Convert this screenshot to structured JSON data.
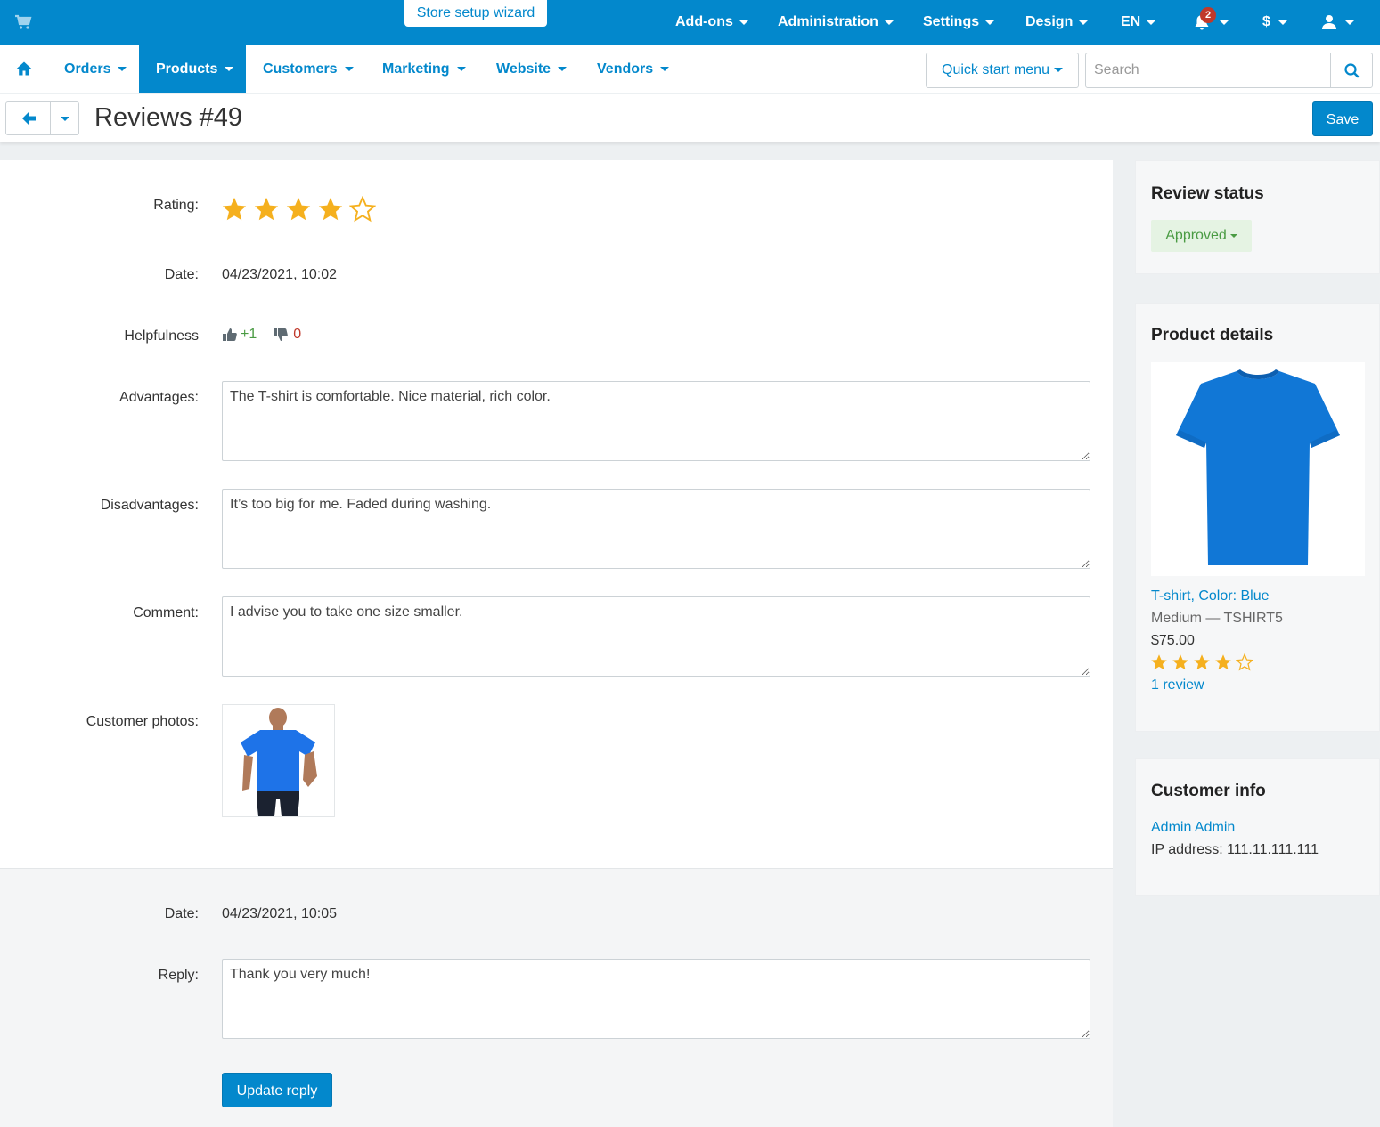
{
  "topbar": {
    "wizard_label": "Store setup wizard",
    "menu": [
      {
        "label": "Add-ons"
      },
      {
        "label": "Administration"
      },
      {
        "label": "Settings"
      },
      {
        "label": "Design"
      },
      {
        "label": "EN"
      }
    ],
    "notifications_count": "2",
    "currency_label": "$"
  },
  "nav": {
    "items": [
      {
        "label": "Orders"
      },
      {
        "label": "Products"
      },
      {
        "label": "Customers"
      },
      {
        "label": "Marketing"
      },
      {
        "label": "Website"
      },
      {
        "label": "Vendors"
      }
    ],
    "active": "Products",
    "quick_start_label": "Quick start menu",
    "search_placeholder": "Search"
  },
  "page": {
    "title": "Reviews #49",
    "save_label": "Save"
  },
  "review": {
    "rating_label": "Rating:",
    "rating": 4,
    "rating_max": 5,
    "date_label": "Date:",
    "date": "04/23/2021, 10:02",
    "helpfulness_label": "Helpfulness",
    "helpful_up": "+1",
    "helpful_down": "0",
    "advantages_label": "Advantages:",
    "advantages": "The T-shirt is comfortable. Nice material, rich color.",
    "disadvantages_label": "Disadvantages:",
    "disadvantages": "It’s too big for me. Faded during washing.",
    "comment_label": "Comment:",
    "comment": "I advise you to take one size smaller.",
    "photos_label": "Customer photos:"
  },
  "reply": {
    "date_label": "Date:",
    "date": "04/23/2021, 10:05",
    "reply_label": "Reply:",
    "reply": "Thank you very much!",
    "update_label": "Update reply"
  },
  "review_status": {
    "title": "Review status",
    "status": "Approved"
  },
  "product_details": {
    "title": "Product details",
    "name": "T-shirt, Color: Blue",
    "variant": "Medium — TSHIRT5",
    "price": "$75.00",
    "rating": 4,
    "reviews_link": "1 review"
  },
  "customer_info": {
    "title": "Customer info",
    "name": "Admin Admin",
    "ip_label": "IP address:",
    "ip": "111.11.111.111"
  },
  "colors": {
    "primary": "#0388cc",
    "star": "#f5b01e",
    "approved_bg": "#e5f3e3",
    "approved_text": "#4a9b43"
  }
}
